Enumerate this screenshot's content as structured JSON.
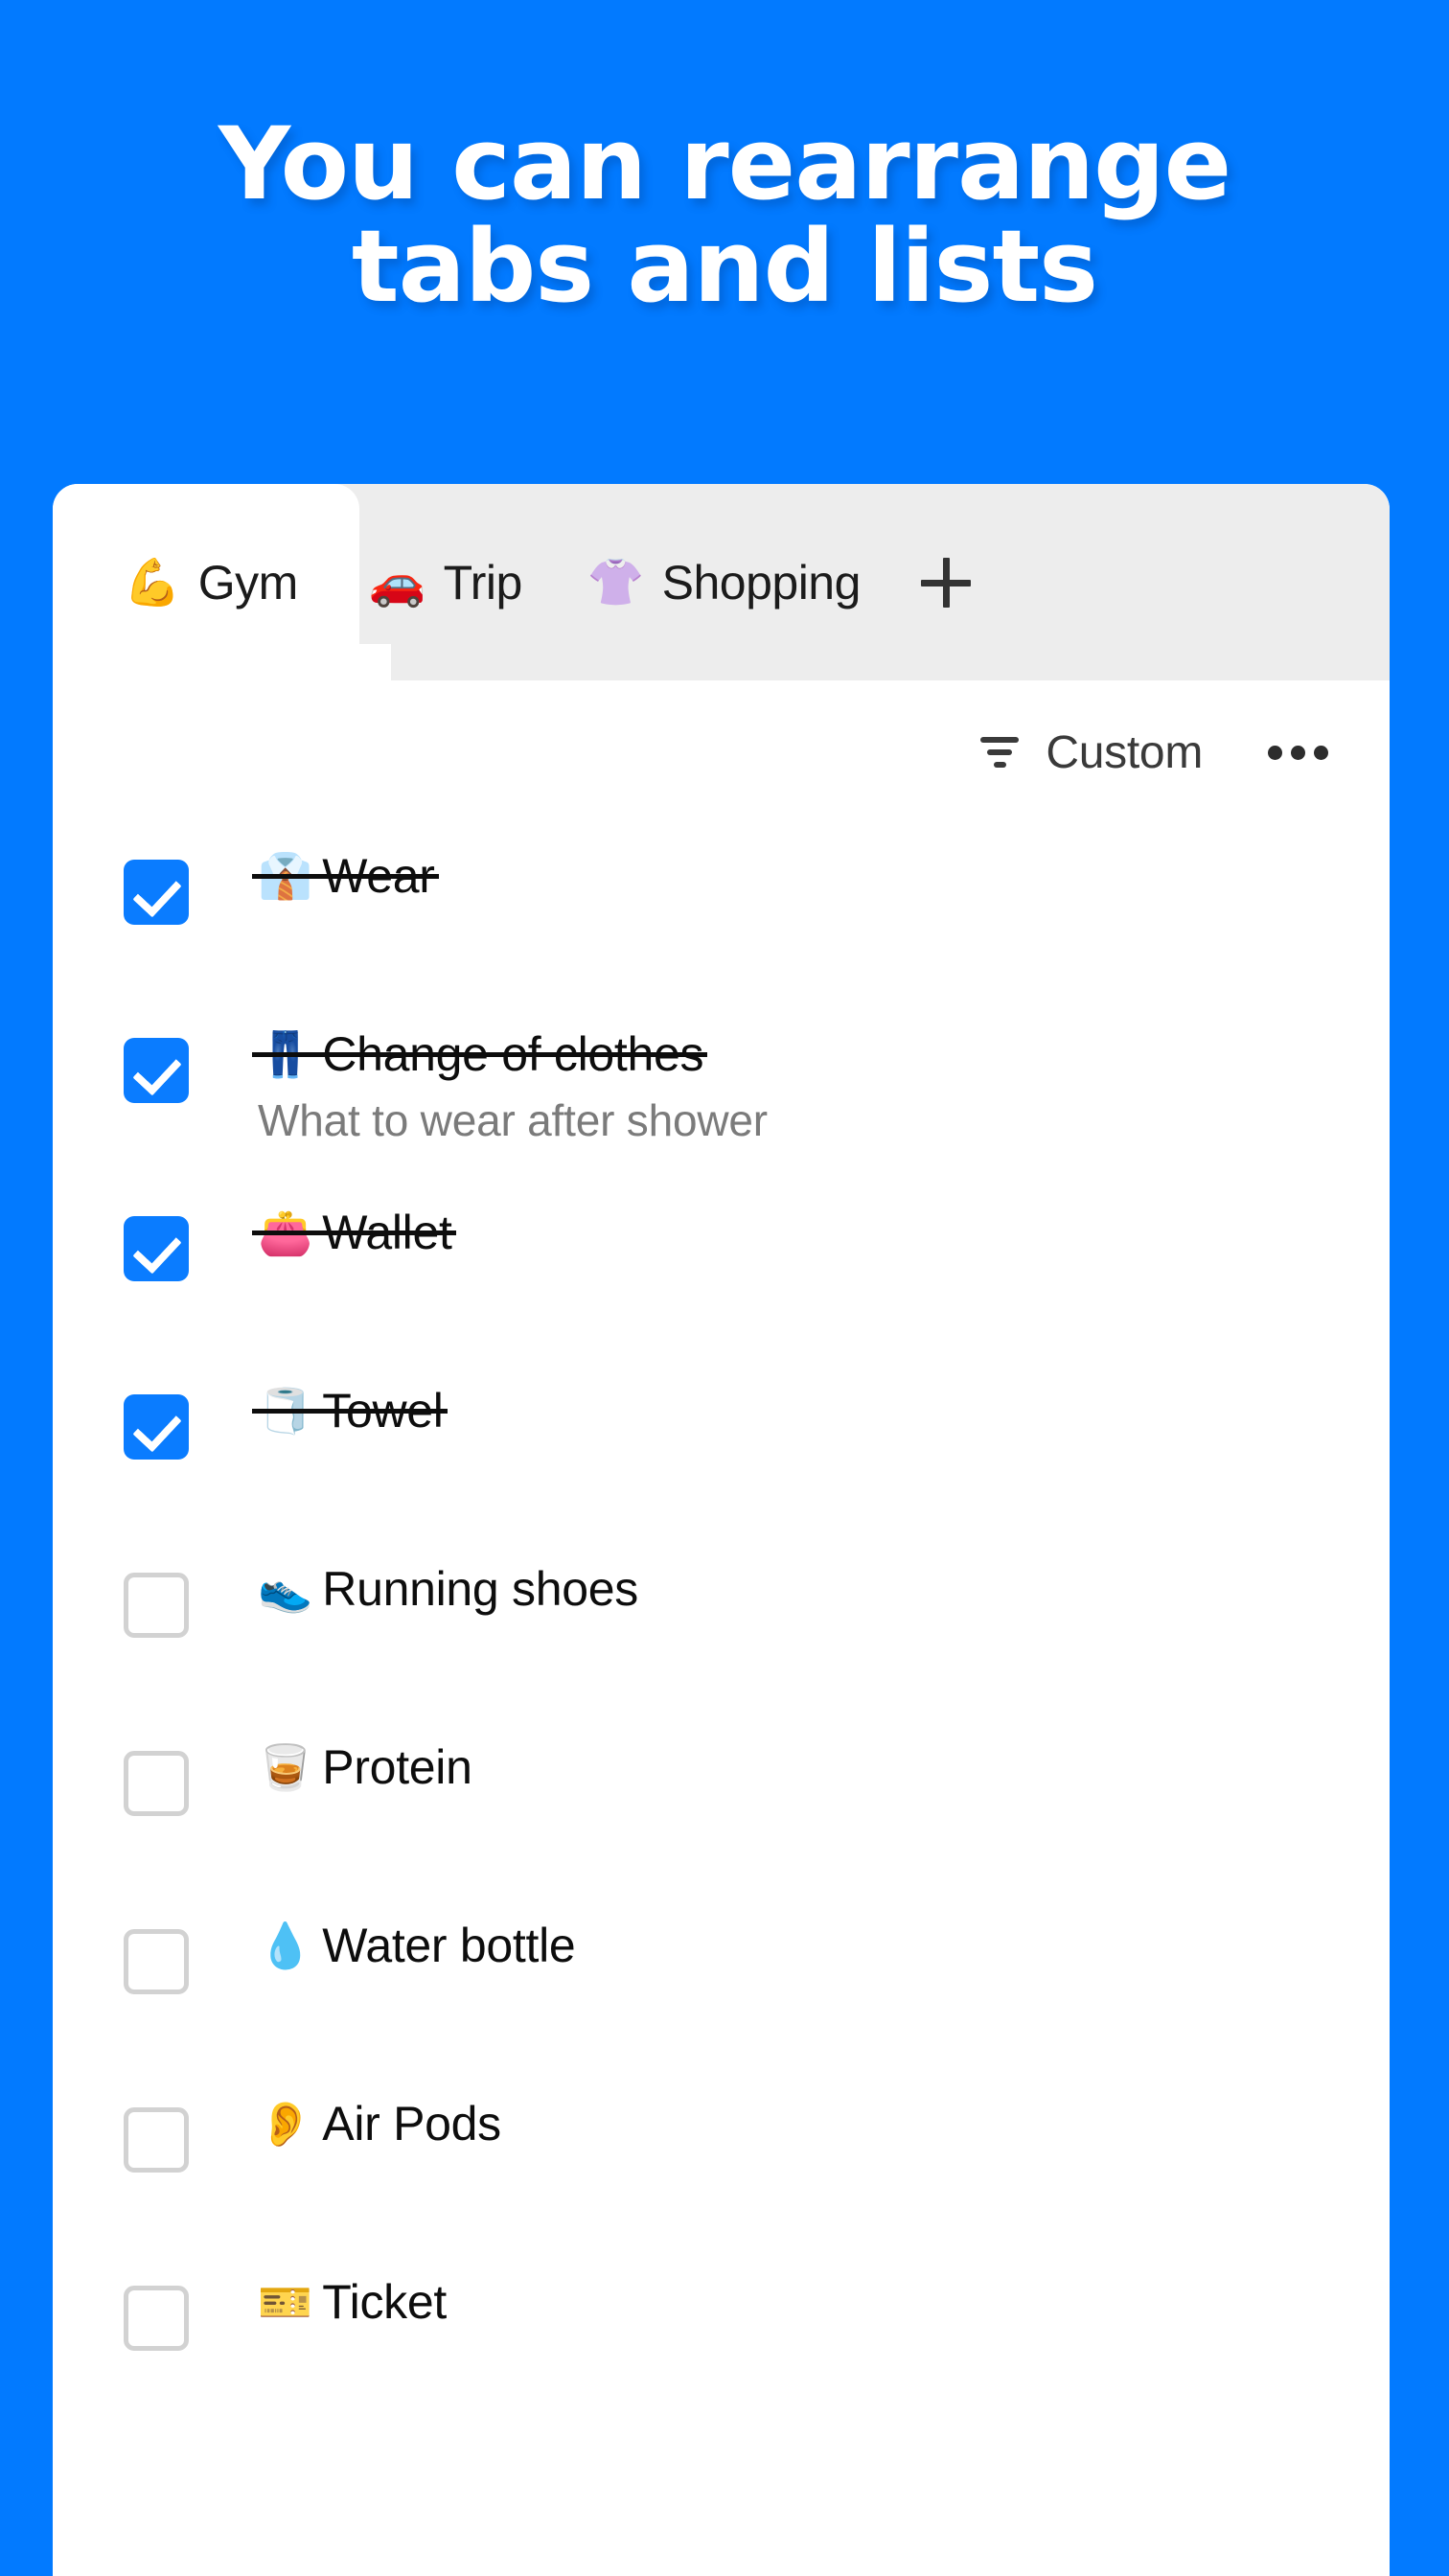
{
  "theme": {
    "background_blue": "#027AFF",
    "checkbox_blue": "#0A7CFF",
    "tabstrip_gray": "#EDEDED",
    "note_gray": "#7B7B7B"
  },
  "headline": "You can rearrange\ntabs and lists",
  "tabs": {
    "items": [
      {
        "emoji": "💪",
        "label": "Gym",
        "active": true
      },
      {
        "emoji": "🚗",
        "label": "Trip",
        "active": false
      },
      {
        "emoji": "👚",
        "label": "Shopping",
        "active": false
      }
    ],
    "add_label": "+"
  },
  "toolbar": {
    "sort_label": "Custom",
    "more_label": "•••"
  },
  "list": {
    "items": [
      {
        "emoji": "👔",
        "title": "Wear",
        "note": "",
        "done": true
      },
      {
        "emoji": "👖",
        "title": "Change of clothes",
        "note": "What to wear after shower",
        "done": true
      },
      {
        "emoji": "👛",
        "title": "Wallet",
        "note": "",
        "done": true
      },
      {
        "emoji": "🧻",
        "title": "Towel",
        "note": "",
        "done": true
      },
      {
        "emoji": "👟",
        "title": "Running shoes",
        "note": "",
        "done": false
      },
      {
        "emoji": "🥃",
        "title": "Protein",
        "note": "",
        "done": false
      },
      {
        "emoji": "💧",
        "title": "Water bottle",
        "note": "",
        "done": false
      },
      {
        "emoji": "👂",
        "title": "Air Pods",
        "note": "",
        "done": false
      },
      {
        "emoji": "🎫",
        "title": "Ticket",
        "note": "",
        "done": false
      }
    ]
  }
}
